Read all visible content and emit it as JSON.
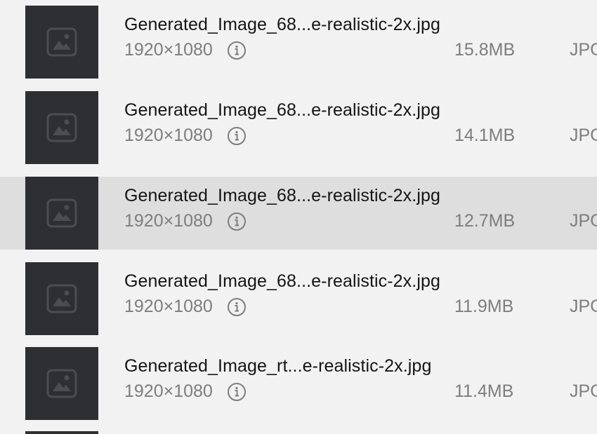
{
  "files": [
    {
      "name": "Generated_Image_68...e-realistic-2x.jpg",
      "dimensions": "1920×1080",
      "size": "15.8MB",
      "type": "JPG",
      "selected": false
    },
    {
      "name": "Generated_Image_68...e-realistic-2x.jpg",
      "dimensions": "1920×1080",
      "size": "14.1MB",
      "type": "JPG",
      "selected": false
    },
    {
      "name": "Generated_Image_68...e-realistic-2x.jpg",
      "dimensions": "1920×1080",
      "size": "12.7MB",
      "type": "JPG",
      "selected": true
    },
    {
      "name": "Generated_Image_68...e-realistic-2x.jpg",
      "dimensions": "1920×1080",
      "size": "11.9MB",
      "type": "JPG",
      "selected": false
    },
    {
      "name": "Generated_Image_rt...e-realistic-2x.jpg",
      "dimensions": "1920×1080",
      "size": "11.4MB",
      "type": "JPG",
      "selected": false
    }
  ],
  "icons": {
    "thumbnail": "image-placeholder-icon",
    "info": "info-icon"
  },
  "colors": {
    "background": "#f2f2f2",
    "selected_row": "#dedede",
    "thumbnail": "#2d2f33",
    "primary_text": "#141414",
    "secondary_text": "#7d7d7d"
  }
}
